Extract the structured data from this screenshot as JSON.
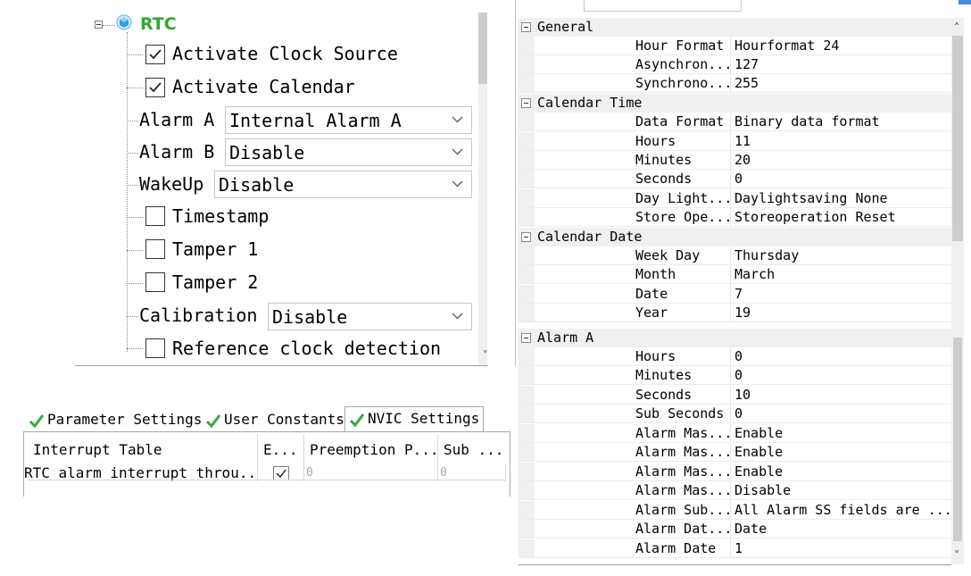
{
  "tree": {
    "root_title": "RTC",
    "activate_clock_source": {
      "label": "Activate Clock Source",
      "checked": true
    },
    "activate_calendar": {
      "label": "Activate Calendar",
      "checked": true
    },
    "alarm_a": {
      "label": "Alarm A",
      "value": "Internal Alarm A"
    },
    "alarm_b": {
      "label": "Alarm B",
      "value": "Disable"
    },
    "wakeup": {
      "label": "WakeUp",
      "value": "Disable"
    },
    "timestamp": {
      "label": "Timestamp",
      "checked": false
    },
    "tamper1": {
      "label": "Tamper 1",
      "checked": false
    },
    "tamper2": {
      "label": "Tamper 2",
      "checked": false
    },
    "calibration": {
      "label": "Calibration",
      "value": "Disable"
    },
    "reference_clock": {
      "label": "Reference clock detection",
      "checked": false
    }
  },
  "tabs": {
    "parameter_settings": "Parameter Settings",
    "user_constants": "User Constants",
    "nvic_settings": "NVIC Settings",
    "active": "NVIC Settings"
  },
  "nvic": {
    "headers": [
      "Interrupt Table",
      "E...",
      "Preemption P...",
      "Sub ..."
    ],
    "rows": [
      {
        "name": "RTC alarm interrupt throu...",
        "enabled": true,
        "preemption": "0",
        "sub": "0"
      }
    ]
  },
  "grid": {
    "general": {
      "title": "General",
      "props": [
        {
          "name": "Hour Format",
          "value": "Hourformat 24"
        },
        {
          "name": "Asynchron...",
          "value": "127"
        },
        {
          "name": "Synchrono...",
          "value": "255"
        }
      ]
    },
    "calendar_time": {
      "title": "Calendar Time",
      "props": [
        {
          "name": "Data Format",
          "value": "Binary data format"
        },
        {
          "name": "Hours",
          "value": "11"
        },
        {
          "name": "Minutes",
          "value": "20"
        },
        {
          "name": "Seconds",
          "value": "0"
        },
        {
          "name": "Day Light...",
          "value": "Daylightsaving None"
        },
        {
          "name": "Store Ope...",
          "value": "Storeoperation Reset"
        }
      ]
    },
    "calendar_date": {
      "title": "Calendar Date",
      "props": [
        {
          "name": "Week Day",
          "value": "Thursday"
        },
        {
          "name": "Month",
          "value": "March"
        },
        {
          "name": "Date",
          "value": "7"
        },
        {
          "name": "Year",
          "value": "19"
        }
      ]
    },
    "alarm_a": {
      "title": "Alarm A",
      "props": [
        {
          "name": "Hours",
          "value": "0"
        },
        {
          "name": "Minutes",
          "value": "0"
        },
        {
          "name": "Seconds",
          "value": "10"
        },
        {
          "name": "Sub Seconds",
          "value": "0"
        },
        {
          "name": "Alarm Mas...",
          "value": "Enable"
        },
        {
          "name": "Alarm Mas...",
          "value": "Enable"
        },
        {
          "name": "Alarm Mas...",
          "value": "Enable"
        },
        {
          "name": "Alarm Mas...",
          "value": "Disable"
        },
        {
          "name": "Alarm Sub...",
          "value": "All Alarm SS fields are ..."
        },
        {
          "name": "Alarm Dat...",
          "value": "Date"
        },
        {
          "name": "Alarm Date",
          "value": "1"
        }
      ]
    }
  },
  "colors": {
    "accent_green": "#2fa632",
    "category_bg": "#f0f0f0",
    "scroll_thumb": "#cdcdcd"
  }
}
